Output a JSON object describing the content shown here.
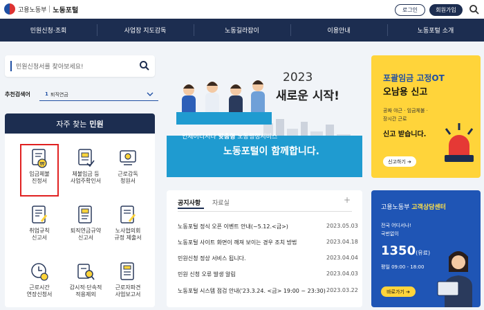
{
  "header": {
    "org": "고용노동부",
    "site": "노동포털",
    "login": "로그인",
    "join": "회원가입"
  },
  "nav": {
    "items": [
      "민원신청·조회",
      "사업장 지도감독",
      "노동길라잡이",
      "이용안내",
      "노동포털 소개"
    ]
  },
  "search": {
    "placeholder": "민원신청서를 찾아보세요!"
  },
  "recommend": {
    "label": "추천검색어",
    "rank": "1",
    "term": "퇴직연금"
  },
  "frequent": {
    "title_a": "자주 찾는",
    "title_b": "민원",
    "items": [
      {
        "label": "임금체불\n진정서",
        "icon": "wage-complaint-icon"
      },
      {
        "label": "체불임금 등\n사업주확인서",
        "icon": "employer-confirmation-icon"
      },
      {
        "label": "근로감독\n청원서",
        "icon": "labor-inspection-icon"
      },
      {
        "label": "취업규칙\n신고서",
        "icon": "work-rules-icon"
      },
      {
        "label": "퇴직연금규약\n신고서",
        "icon": "pension-rules-icon"
      },
      {
        "label": "노사협의회\n규정 제출서",
        "icon": "council-rules-icon"
      },
      {
        "label": "근로시간\n연장신청서",
        "icon": "work-hours-icon"
      },
      {
        "label": "감시적·단속적\n적용제외",
        "icon": "exemption-icon"
      },
      {
        "label": "근로자파견\n사업보고서",
        "icon": "dispatch-report-icon"
      }
    ]
  },
  "banner": {
    "year": "2023",
    "headline": "새로운 시작!",
    "sub_a": "언제어디서나",
    "sub_b": "맞춤형",
    "sub_c": "노동행정서비스",
    "main": "노동포털이 함께합니다."
  },
  "promo": {
    "title_a": "포괄임금 고정OT",
    "title_b": "오남용 신고",
    "desc": "공짜 야근 · 임금체불 ·\n장시간 근로",
    "desc2": "신고 받습니다.",
    "button": "신고하기 ➔"
  },
  "notice": {
    "tab_active": "공지사항",
    "tab_other": "자료실",
    "more": "+",
    "rows": [
      {
        "title": "노동포털 정식 오픈 이벤트 안내(~5.12.<금>)",
        "date": "2023.05.03"
      },
      {
        "title": "노동포털 사이트 화면이 깨져 보이는 경우 조치 방법",
        "date": "2023.04.18"
      },
      {
        "title": "민원신청 정상 서비스 됩니다.",
        "date": "2023.04.04"
      },
      {
        "title": "민원 신청 오류 발생 알림",
        "date": "2023.04.03"
      },
      {
        "title": "노동포털 시스템 점검 안내('23.3.24. <금> 19:00 ~ 23:30)",
        "date": "2023.03.22"
      }
    ]
  },
  "consult": {
    "title_a": "고용노동부",
    "title_b": "고객상담센터",
    "sub": "전국 어디서나!\n국번없이",
    "number": "1350",
    "number_note": "(유료)",
    "hours": "평일 09:00 - 18:00",
    "button": "바로가기 ➔"
  },
  "colors": {
    "navy": "#1c2d50",
    "blue": "#1f55b5",
    "yellow": "#ffd43a",
    "highlight": "#e02020"
  }
}
